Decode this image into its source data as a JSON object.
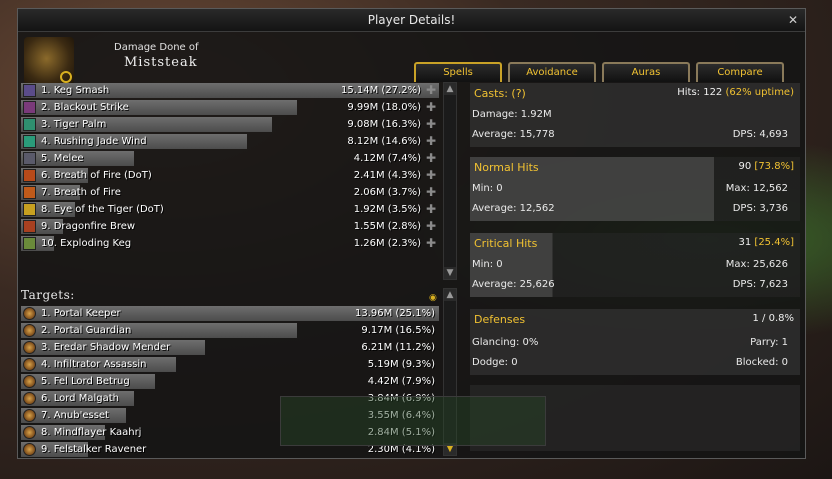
{
  "window": {
    "title": "Player Details!"
  },
  "header": {
    "subtitle": "Damage Done of",
    "player_name": "Miststeak"
  },
  "tabs": [
    {
      "label": "Spells",
      "active": true
    },
    {
      "label": "Avoidance",
      "active": false
    },
    {
      "label": "Auras",
      "active": false
    },
    {
      "label": "Compare",
      "active": false
    }
  ],
  "spells": [
    {
      "label": "1. Keg Smash",
      "value": "15.14M (27.2%)",
      "fraction": 1.0,
      "icon_color": "#5b4c8a",
      "icon": "keg-smash-icon"
    },
    {
      "label": "2. Blackout Strike",
      "value": "9.99M (18.0%)",
      "fraction": 0.66,
      "icon_color": "#7a3a7a",
      "icon": "blackout-strike-icon"
    },
    {
      "label": "3. Tiger Palm",
      "value": "9.08M (16.3%)",
      "fraction": 0.6,
      "icon_color": "#2f8f6f",
      "icon": "tiger-palm-icon"
    },
    {
      "label": "4. Rushing Jade Wind",
      "value": "8.12M (14.6%)",
      "fraction": 0.54,
      "icon_color": "#2a9b7a",
      "icon": "rushing-jade-wind-icon"
    },
    {
      "label": "5. Melee",
      "value": "4.12M (7.4%)",
      "fraction": 0.27,
      "icon_color": "#5a5a6a",
      "icon": "melee-icon"
    },
    {
      "label": "6. Breath of Fire (DoT)",
      "value": "2.41M (4.3%)",
      "fraction": 0.16,
      "icon_color": "#b84a1a",
      "icon": "breath-of-fire-dot-icon"
    },
    {
      "label": "7. Breath of Fire",
      "value": "2.06M (3.7%)",
      "fraction": 0.14,
      "icon_color": "#c05a1a",
      "icon": "breath-of-fire-icon"
    },
    {
      "label": "8. Eye of the Tiger (DoT)",
      "value": "1.92M (3.5%)",
      "fraction": 0.13,
      "icon_color": "#c8a020",
      "icon": "eye-of-the-tiger-icon"
    },
    {
      "label": "9. Dragonfire Brew",
      "value": "1.55M (2.8%)",
      "fraction": 0.1,
      "icon_color": "#a84020",
      "icon": "dragonfire-brew-icon"
    },
    {
      "label": "10. Exploding Keg",
      "value": "1.26M (2.3%)",
      "fraction": 0.08,
      "icon_color": "#6a8a3a",
      "icon": "exploding-keg-icon"
    }
  ],
  "targets_title": "Targets:",
  "targets": [
    {
      "label": "1. Portal Keeper",
      "value": "13.96M (25.1%)",
      "fraction": 1.0
    },
    {
      "label": "2. Portal Guardian",
      "value": "9.17M (16.5%)",
      "fraction": 0.66
    },
    {
      "label": "3. Eredar Shadow Mender",
      "value": "6.21M (11.2%)",
      "fraction": 0.44
    },
    {
      "label": "4. Infiltrator Assassin",
      "value": "5.19M (9.3%)",
      "fraction": 0.37
    },
    {
      "label": "5. Fel Lord Betrug",
      "value": "4.42M (7.9%)",
      "fraction": 0.32
    },
    {
      "label": "6. Lord Malgath",
      "value": "3.84M (6.9%)",
      "fraction": 0.27
    },
    {
      "label": "7. Anub'esset",
      "value": "3.55M (6.4%)",
      "fraction": 0.25
    },
    {
      "label": "8. Mindflayer Kaahrj",
      "value": "2.84M (5.1%)",
      "fraction": 0.2
    },
    {
      "label": "9. Felstalker Ravener",
      "value": "2.30M (4.1%)",
      "fraction": 0.16
    }
  ],
  "casts": {
    "title": "Casts: (?)",
    "hits_label": "Hits: 122",
    "uptime": "(62% uptime)",
    "damage": "Damage: 1.92M",
    "average": "Average: 15,778",
    "dps": "DPS: 4,693"
  },
  "normal_hits": {
    "title": "Normal Hits",
    "count": "90",
    "pct": "[73.8%]",
    "min": "Min: 0",
    "max": "Max: 12,562",
    "average": "Average: 12,562",
    "dps": "DPS: 3,736"
  },
  "critical_hits": {
    "title": "Critical Hits",
    "count": "31",
    "pct": "[25.4%]",
    "min": "Min: 0",
    "max": "Max: 25,626",
    "average": "Average: 25,626",
    "dps": "DPS: 7,623"
  },
  "defenses": {
    "title": "Defenses",
    "ratio": "1 / 0.8%",
    "glancing": "Glancing: 0%",
    "parry": "Parry: 1",
    "dodge": "Dodge: 0",
    "blocked": "Blocked: 0"
  },
  "colors": {
    "accent": "#f1c232",
    "bar": "#5c5c5c"
  }
}
